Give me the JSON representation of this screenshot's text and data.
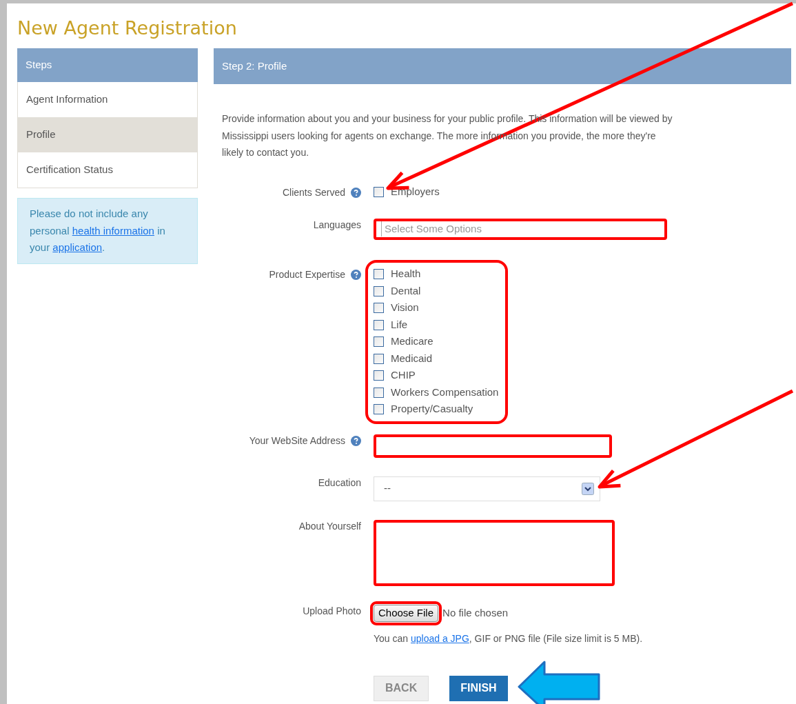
{
  "title": "New Agent Registration",
  "sidebar": {
    "header": "Steps",
    "steps": [
      {
        "label": "Agent Information",
        "selected": false
      },
      {
        "label": "Profile",
        "selected": true
      },
      {
        "label": "Certification Status",
        "selected": false
      }
    ],
    "notice": [
      {
        "kind": "text",
        "text": "Please do not include any personal "
      },
      {
        "kind": "link",
        "text": "health information"
      },
      {
        "kind": "text",
        "text": " in your "
      },
      {
        "kind": "link",
        "text": "application"
      },
      {
        "kind": "text",
        "text": "."
      }
    ]
  },
  "main": {
    "header": "Step 2: Profile",
    "intro": "Provide information about you and your business for your public profile. This information will be viewed by Mississippi users looking for agents on exchange. The more information you provide, the more they're likely to contact you.",
    "fields": [
      {
        "kind": "checkboxes",
        "label": "Clients Served",
        "help": true,
        "highlighted": false,
        "options": [
          {
            "label": "Employers",
            "checked": false
          }
        ]
      },
      {
        "kind": "multiselect",
        "label": "Languages",
        "help": false,
        "highlighted": true,
        "placeholder": "Select Some Options"
      },
      {
        "kind": "checkboxes",
        "label": "Product Expertise",
        "help": true,
        "highlighted": true,
        "options": [
          {
            "label": "Health",
            "checked": false
          },
          {
            "label": "Dental",
            "checked": false
          },
          {
            "label": "Vision",
            "checked": false
          },
          {
            "label": "Life",
            "checked": false
          },
          {
            "label": "Medicare",
            "checked": false
          },
          {
            "label": "Medicaid",
            "checked": false
          },
          {
            "label": "CHIP",
            "checked": false
          },
          {
            "label": "Workers Compensation",
            "checked": false
          },
          {
            "label": "Property/Casualty",
            "checked": false
          }
        ]
      },
      {
        "kind": "text",
        "label": "Your WebSite Address",
        "help": true,
        "highlighted": true
      },
      {
        "kind": "select",
        "label": "Education",
        "help": false,
        "highlighted": false,
        "value": "--"
      },
      {
        "kind": "textarea",
        "label": "About Yourself",
        "help": false,
        "highlighted": true
      },
      {
        "kind": "file",
        "label": "Upload Photo",
        "help": false,
        "highlighted": true,
        "button": "Choose File",
        "status": "No file chosen",
        "hint": [
          {
            "kind": "text",
            "text": "You can "
          },
          {
            "kind": "link",
            "text": "upload a JPG"
          },
          {
            "kind": "text",
            "text": ", GIF or PNG file (File size limit is 5 MB)."
          }
        ]
      }
    ],
    "buttons": [
      {
        "kind": "secondary",
        "label": "BACK"
      },
      {
        "kind": "primary",
        "label": "FINISH"
      }
    ]
  }
}
